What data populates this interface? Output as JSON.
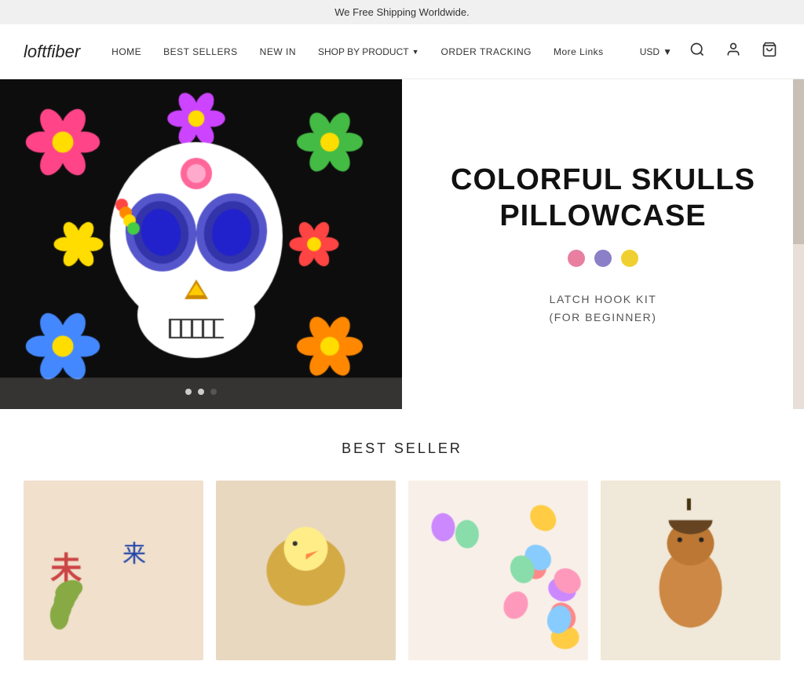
{
  "banner": {
    "text": "We Free Shipping Worldwide."
  },
  "header": {
    "logo": "loftfiber",
    "nav": [
      {
        "label": "HOME",
        "id": "home"
      },
      {
        "label": "BEST SELLERS",
        "id": "best-sellers"
      },
      {
        "label": "NEW IN",
        "id": "new-in"
      },
      {
        "label": "SHOP BY PRODUCT",
        "id": "shop-by-product",
        "hasDropdown": true
      },
      {
        "label": "ORDER TRACKING",
        "id": "order-tracking"
      },
      {
        "label": "More Links",
        "id": "more-links"
      }
    ],
    "currency": "USD",
    "icons": {
      "search": "🔍",
      "account": "👤",
      "cart": "🛒"
    }
  },
  "hero": {
    "title_line1": "COLORFUL SKULLS",
    "title_line2": "PILLOWCASE",
    "colors": [
      "#e87fa0",
      "#8b7fc7",
      "#f0d030"
    ],
    "subtitle_line1": "LATCH HOOK KIT",
    "subtitle_line2": "(FOR BEGINNER)",
    "slides": 3,
    "active_slide": 2
  },
  "best_seller": {
    "title": "BEST SELLER",
    "products": [
      {
        "id": 1,
        "alt": "Japanese art product"
      },
      {
        "id": 2,
        "alt": "Duck craft product"
      },
      {
        "id": 3,
        "alt": "Colorful plush toys"
      },
      {
        "id": 4,
        "alt": "Squirrel craft product"
      }
    ]
  }
}
